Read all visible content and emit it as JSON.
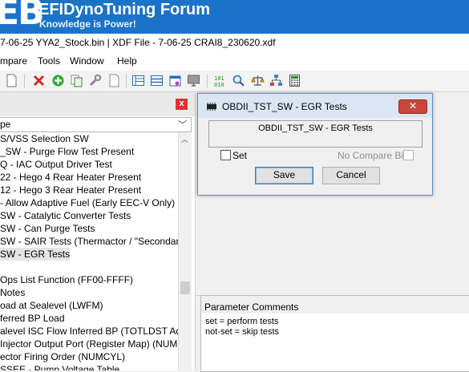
{
  "banner": {
    "logo_text": "EB",
    "title": "EFIDynoTuning Forum",
    "tagline": "Knowledge is Power!"
  },
  "window": {
    "title": "7-06-25 YYA2_Stock.bin | XDF File - 7-06-25 CRAI8_230620.xdf"
  },
  "menu": [
    "mpare",
    "Tools",
    "Window",
    "Help"
  ],
  "toolbar": {
    "icons": [
      "new-doc-icon",
      "delete-icon",
      "add-icon",
      "copy-icon",
      "wrench-icon",
      "page-icon",
      "view-list-icon",
      "view-table-icon",
      "calendar-icon",
      "monitor-icon",
      "binary-icon",
      "search-icon",
      "compare-scale-icon",
      "hierarchy-icon",
      "calculator-icon"
    ]
  },
  "left_panel": {
    "close_label": "x",
    "selected_type": "pe",
    "rows": [
      {
        "text": "S/VSS Selection SW",
        "selected": false
      },
      {
        "text": "_SW - Purge Flow Test Present",
        "selected": false
      },
      {
        "text": "Q - IAC Output Driver Test",
        "selected": false
      },
      {
        "text": "22 - Hego 4 Rear Heater Present",
        "selected": false
      },
      {
        "text": "12 - Hego 3 Rear Heater Present",
        "selected": false
      },
      {
        "text": "- Allow Adaptive Fuel (Early EEC-V Only)",
        "selected": false
      },
      {
        "text": "SW - Catalytic Converter Tests",
        "selected": false
      },
      {
        "text": "SW - Can Purge Tests",
        "selected": false
      },
      {
        "text": "SW - SAIR Tests (Thermactor / \"Secondary Air",
        "selected": false
      },
      {
        "text": "SW - EGR Tests",
        "selected": true
      },
      {
        "text": "",
        "selected": false
      },
      {
        "text": "Ops List Function (FF00-FFFF)",
        "selected": false
      },
      {
        "text": "Notes",
        "selected": false
      },
      {
        "text": "oad at Sealevel (LWFM)",
        "selected": false
      },
      {
        "text": "ferred BP Load",
        "selected": false
      },
      {
        "text": "alevel ISC Flow Inferred BP (TOTLDST Adder)",
        "selected": false
      },
      {
        "text": " Injector Output Port (Register Map)  (NUMCYL",
        "selected": false
      },
      {
        "text": "ector Firing Order (NUMCYL)",
        "selected": false
      },
      {
        "text": "SSEE - Pump Voltage Table",
        "selected": false
      }
    ]
  },
  "dialog": {
    "title": "OBDII_TST_SW - EGR Tests",
    "close_label": "✕",
    "label": "OBDII_TST_SW - EGR Tests",
    "set_label": "Set",
    "set_checked": false,
    "no_compare_label": "No Compare Bin",
    "no_compare_checked": false,
    "save_label": "Save",
    "cancel_label": "Cancel"
  },
  "comments": {
    "title": "Parameter Comments",
    "lines": [
      "set = perform tests",
      "not-set = skip tests"
    ]
  }
}
